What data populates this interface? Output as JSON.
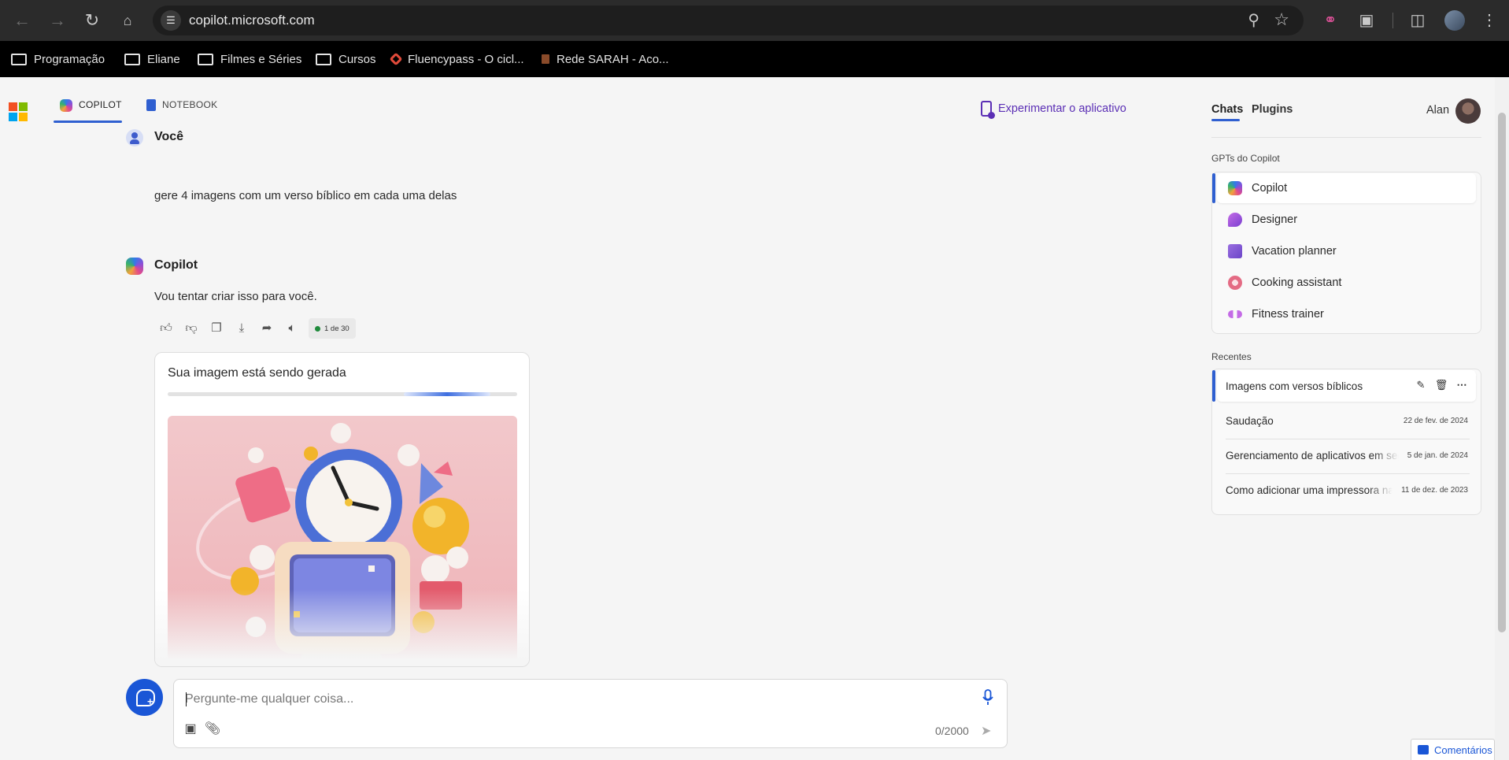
{
  "browser": {
    "url": "copilot.microsoft.com",
    "bookmarks": [
      {
        "label": "Programação",
        "icon": "folder-icon"
      },
      {
        "label": "Eliane",
        "icon": "folder-icon"
      },
      {
        "label": "Filmes e Séries",
        "icon": "folder-icon"
      },
      {
        "label": "Cursos",
        "icon": "folder-icon"
      },
      {
        "label": "Fluencypass - O cicl...",
        "icon": "fluencypass-favicon"
      },
      {
        "label": "Rede SARAH - Aco...",
        "icon": "sarah-favicon"
      }
    ]
  },
  "header": {
    "tabs": [
      {
        "label": "COPILOT",
        "active": true
      },
      {
        "label": "NOTEBOOK",
        "active": false
      }
    ],
    "try_app": "Experimentar o aplicativo"
  },
  "conversation": {
    "user_name": "Você",
    "user_message": "gere 4 imagens com um verso bíblico em cada uma delas",
    "bot_name": "Copilot",
    "bot_message": "Vou tentar criar isso para você.",
    "counter": "1 de 30",
    "generating_title": "Sua imagem está sendo gerada"
  },
  "composer": {
    "placeholder": "Pergunte-me qualquer coisa...",
    "char_count": "0/2000"
  },
  "sidebar": {
    "tabs": [
      {
        "label": "Chats",
        "active": true
      },
      {
        "label": "Plugins",
        "active": false
      }
    ],
    "user_name": "Alan",
    "gpts_label": "GPTs do Copilot",
    "gpts": [
      {
        "label": "Copilot",
        "color": "#4a7be8"
      },
      {
        "label": "Designer",
        "color": "#a14fd8"
      },
      {
        "label": "Vacation planner",
        "color": "#8e5bd6"
      },
      {
        "label": "Cooking assistant",
        "color": "#e46b84"
      },
      {
        "label": "Fitness trainer",
        "color": "#b05bd6"
      }
    ],
    "recent_label": "Recentes",
    "recents": [
      {
        "title": "Imagens com versos bíblicos",
        "date": ""
      },
      {
        "title": "Saudação",
        "date": "22 de fev. de 2024"
      },
      {
        "title": "Gerenciamento de aplicativos em segundo plano",
        "date": "5 de jan. de 2024"
      },
      {
        "title": "Como adicionar uma impressora na rede",
        "date": "11 de dez. de 2023"
      }
    ]
  },
  "feedback_label": "Comentários",
  "colors": {
    "accent": "#2f5fd0",
    "try_app": "#5b2fb5",
    "new_topic_button": "#1a56d6"
  }
}
